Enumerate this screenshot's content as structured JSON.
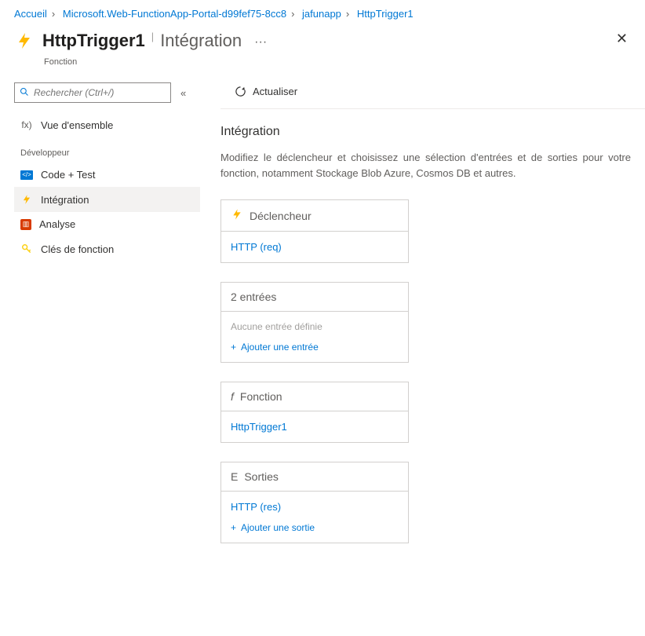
{
  "breadcrumb": {
    "items": [
      "Accueil",
      "Microsoft.Web-FunctionApp-Portal-d99fef75-8cc8",
      "jafunapp",
      "HttpTrigger1"
    ]
  },
  "header": {
    "title": "HttpTrigger1",
    "subtitle": "Intégration",
    "kind": "Fonction"
  },
  "sidebar": {
    "search_placeholder": "Rechercher (Ctrl+/)",
    "overview": "Vue d'ensemble",
    "section_label": "Développeur",
    "items": [
      {
        "label": "Code + Test"
      },
      {
        "label": "Intégration"
      },
      {
        "label": "Analyse"
      },
      {
        "label": "Clés de fonction"
      }
    ]
  },
  "toolbar": {
    "refresh": "Actualiser"
  },
  "integration": {
    "heading": "Intégration",
    "description": "Modifiez le déclencheur et choisissez une sélection d'entrées et de sorties pour votre fonction, notamment Stockage Blob Azure, Cosmos DB et autres."
  },
  "cards": {
    "trigger": {
      "title": "Déclencheur",
      "value": "HTTP (req)"
    },
    "inputs": {
      "title": "2 entrées",
      "none": "Aucune entrée définie",
      "add": "Ajouter une entrée"
    },
    "function": {
      "prefix": "f",
      "title": "Fonction",
      "value": "HttpTrigger1"
    },
    "outputs": {
      "prefix": "E",
      "title": "Sorties",
      "value": "HTTP (res)",
      "add": "Ajouter une sortie"
    }
  }
}
